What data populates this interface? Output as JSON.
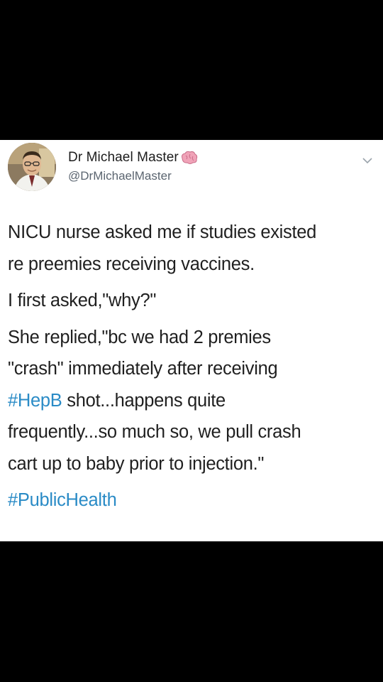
{
  "tweet": {
    "author": {
      "display_name": "Dr Michael Master",
      "handle": "@DrMichaelMaster",
      "name_emoji": "brain-icon"
    },
    "menu_icon": "chevron-down-icon",
    "lines": {
      "p1_l1": "NICU nurse asked me if studies existed",
      "p1_l2": "re preemies receiving vaccines.",
      "p2_l1": "I first asked,\"why?\"",
      "p3_l1": "She replied,\"bc we had 2 premies",
      "p3_l2": "\"crash\" immediately after receiving",
      "p3_l3_hashtag": "#HepB",
      "p3_l3_rest": " shot...happens quite",
      "p3_l4": "frequently...so much so, we pull crash",
      "p3_l5": "cart up to baby prior to injection.\"",
      "p4_hashtag": "#PublicHealth"
    },
    "colors": {
      "hashtag": "#2a8bc6",
      "text": "#1f1f1f",
      "handle": "#5b6570",
      "background": "#ffffff",
      "letterbox": "#000000"
    }
  }
}
